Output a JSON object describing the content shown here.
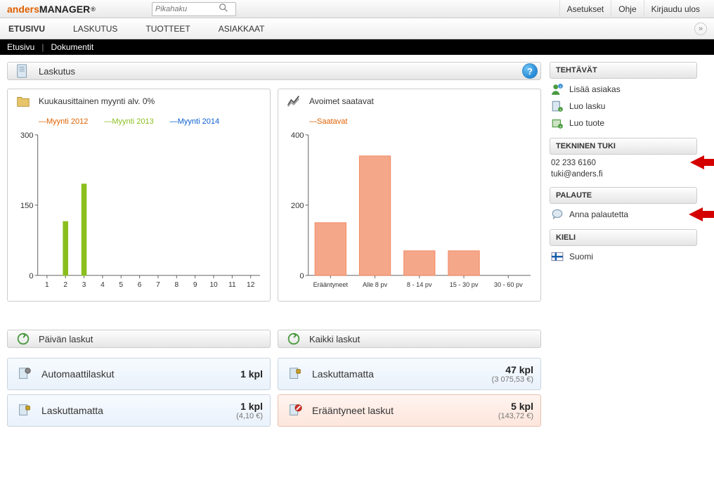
{
  "logo": {
    "a": "anders",
    "b": "MANAGER",
    "r": "®"
  },
  "search": {
    "placeholder": "Pikahaku"
  },
  "topnav": {
    "settings": "Asetukset",
    "help": "Ohje",
    "logout": "Kirjaudu ulos"
  },
  "mainnav": {
    "home": "ETUSIVU",
    "billing": "LASKUTUS",
    "products": "TUOTTEET",
    "customers": "ASIAKKAAT",
    "more": "»"
  },
  "breadcrumb": {
    "home": "Etusivu",
    "docs": "Dokumentit"
  },
  "page": {
    "title": "Laskutus"
  },
  "charts_row": {
    "monthly": {
      "title": "Kuukausittainen myynti alv. 0%"
    },
    "open": {
      "title": "Avoimet saatavat"
    }
  },
  "legend": {
    "y2012": "Myynti 2012",
    "y2013": "Myynti 2013",
    "y2014": "Myynti 2014",
    "saatavat": "Saatavat"
  },
  "chart_data": [
    {
      "type": "bar",
      "title": "Kuukausittainen myynti alv. 0%",
      "xlabel": "",
      "ylabel": "",
      "ylim": [
        0,
        300
      ],
      "categories": [
        "1",
        "2",
        "3",
        "4",
        "5",
        "6",
        "7",
        "8",
        "9",
        "10",
        "11",
        "12"
      ],
      "series": [
        {
          "name": "Myynti 2012",
          "color": "#e06000",
          "values": [
            0,
            0,
            0,
            0,
            0,
            0,
            0,
            0,
            0,
            0,
            0,
            0
          ]
        },
        {
          "name": "Myynti 2013",
          "color": "#8abf1f",
          "values": [
            0,
            115,
            195,
            0,
            0,
            0,
            0,
            0,
            0,
            0,
            0,
            0
          ]
        },
        {
          "name": "Myynti 2014",
          "color": "#0b5ed1",
          "values": [
            0,
            0,
            0,
            0,
            0,
            0,
            0,
            0,
            0,
            0,
            0,
            0
          ]
        }
      ]
    },
    {
      "type": "bar",
      "title": "Avoimet saatavat",
      "xlabel": "",
      "ylabel": "",
      "ylim": [
        0,
        400
      ],
      "categories": [
        "Erääntyneet",
        "Alle 8 pv",
        "8 - 14 pv",
        "15 - 30 pv",
        "30 - 60 pv"
      ],
      "series": [
        {
          "name": "Saatavat",
          "color": "#f28a63",
          "values": [
            150,
            340,
            70,
            70,
            0
          ]
        }
      ]
    }
  ],
  "kpi": {
    "day_head": "Päivän laskut",
    "all_head": "Kaikki laskut",
    "auto": {
      "label": "Automaattilaskut",
      "count": "1 kpl"
    },
    "unbilled_d": {
      "label": "Laskuttamatta",
      "count": "1 kpl",
      "amount": "(4,10 €)"
    },
    "unbilled_a": {
      "label": "Laskuttamatta",
      "count": "47 kpl",
      "amount": "(3 075,53 €)"
    },
    "overdue": {
      "label": "Erääntyneet laskut",
      "count": "5 kpl",
      "amount": "(143,72 €)"
    }
  },
  "sidebar": {
    "tasks_head": "TEHTÄVÄT",
    "tasks": {
      "add_customer": "Lisää asiakas",
      "create_invoice": "Luo lasku",
      "create_product": "Luo tuote"
    },
    "support_head": "TEKNINEN TUKI",
    "support": {
      "phone": "02 233 6160",
      "email": "tuki@anders.fi"
    },
    "feedback_head": "PALAUTE",
    "feedback": {
      "give": "Anna palautetta"
    },
    "lang_head": "KIELI",
    "lang": {
      "fi": "Suomi"
    }
  }
}
